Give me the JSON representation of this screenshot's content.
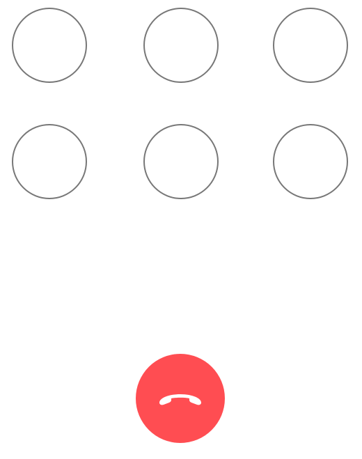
{
  "call_controls": {
    "buttons": [
      {
        "label": ""
      },
      {
        "label": ""
      },
      {
        "label": ""
      },
      {
        "label": ""
      },
      {
        "label": ""
      },
      {
        "label": ""
      }
    ]
  },
  "end_call": {
    "icon": "phone-hangup-icon",
    "color": "#ff4d52"
  }
}
